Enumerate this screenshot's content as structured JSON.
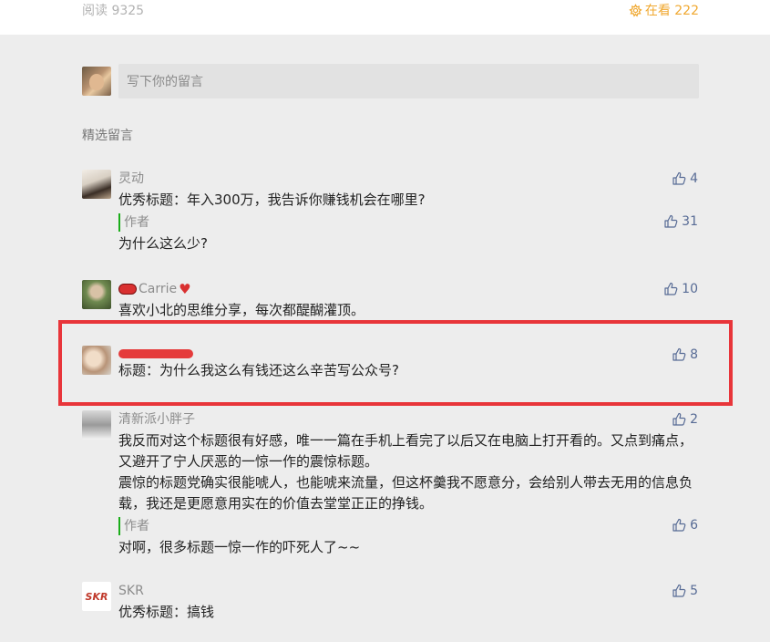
{
  "header": {
    "read_label": "阅读 9325",
    "watching_label": "在看 222"
  },
  "composer": {
    "placeholder": "写下你的留言"
  },
  "section_title": "精选留言",
  "comments": [
    {
      "nick": "灵动",
      "text": "优秀标题：年入300万，我告诉你赚钱机会在哪里?",
      "likes": "4",
      "reply": {
        "author_label": "作者",
        "text": "为什么这么少?",
        "likes": "31"
      }
    },
    {
      "nick": "Carrie",
      "text": "喜欢小北的思维分享，每次都醍醐灌顶。",
      "likes": "10"
    },
    {
      "nick": "",
      "text": "标题：为什么我这么有钱还这么辛苦写公众号?",
      "likes": "8"
    },
    {
      "nick": "清新派小胖子",
      "text": "我反而对这个标题很有好感，唯一一篇在手机上看完了以后又在电脑上打开看的。又点到痛点，又避开了宁人厌恶的一惊一作的震惊标题。",
      "text2": "震惊的标题党确实很能唬人，也能唬来流量，但这杯羹我不愿意分，会给别人带去无用的信息负载，我还是更愿意用实在的价值去堂堂正正的挣钱。",
      "likes": "2",
      "reply": {
        "author_label": "作者",
        "text": "对啊，很多标题一惊一作的吓死人了~~",
        "likes": "6"
      }
    },
    {
      "nick": "SKR",
      "avatar_text": "SKR",
      "text": "优秀标题：搞钱",
      "likes": "5"
    }
  ],
  "colors": {
    "accent_link": "#576b95",
    "watching": "#f0a830",
    "highlight": "#e8353a",
    "author_bar": "#1aad19"
  }
}
